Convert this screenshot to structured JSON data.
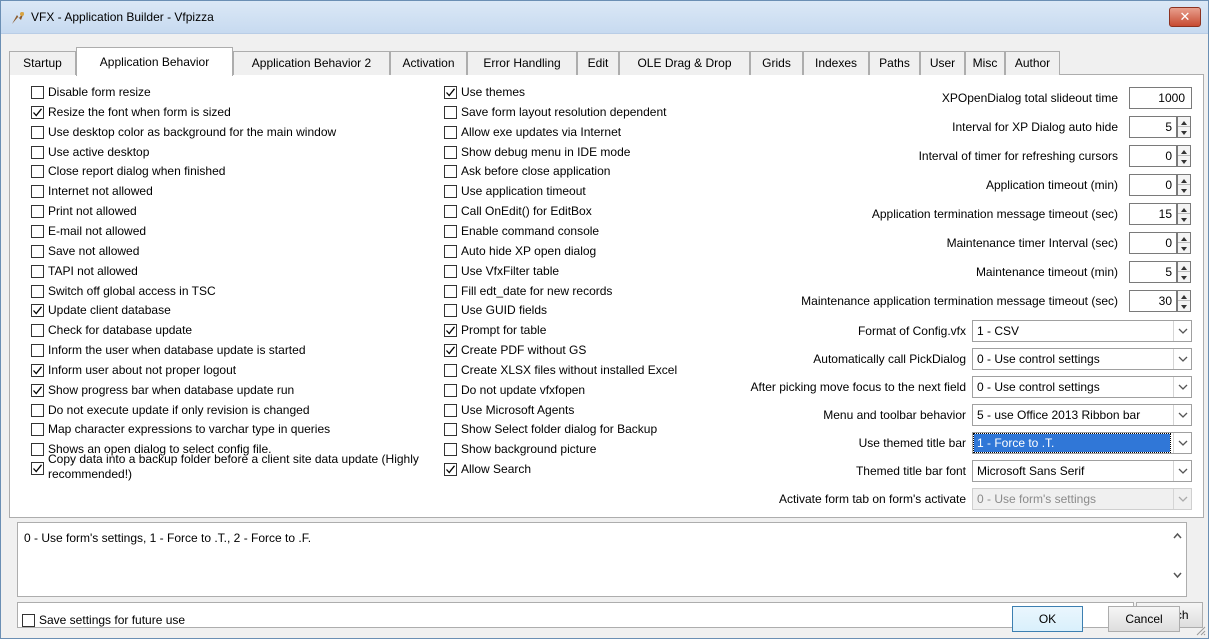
{
  "window": {
    "title": "VFX - Application Builder - Vfpizza",
    "close_label": "✕"
  },
  "tabs": [
    {
      "label": "Startup"
    },
    {
      "label": "Application Behavior"
    },
    {
      "label": "Application Behavior 2"
    },
    {
      "label": "Activation"
    },
    {
      "label": "Error Handling"
    },
    {
      "label": "Edit"
    },
    {
      "label": "OLE Drag & Drop"
    },
    {
      "label": "Grids"
    },
    {
      "label": "Indexes"
    },
    {
      "label": "Paths"
    },
    {
      "label": "User"
    },
    {
      "label": "Misc"
    },
    {
      "label": "Author"
    }
  ],
  "active_tab": "Application Behavior",
  "left_checks": [
    {
      "label": "Disable form resize",
      "checked": false
    },
    {
      "label": "Resize the font when form is sized",
      "checked": true
    },
    {
      "label": "Use desktop color as background for the main window",
      "checked": false
    },
    {
      "label": "Use active desktop",
      "checked": false
    },
    {
      "label": "Close report dialog when finished",
      "checked": false
    },
    {
      "label": "Internet not allowed",
      "checked": false
    },
    {
      "label": "Print not allowed",
      "checked": false
    },
    {
      "label": "E-mail not allowed",
      "checked": false
    },
    {
      "label": "Save not allowed",
      "checked": false
    },
    {
      "label": "TAPI not allowed",
      "checked": false
    },
    {
      "label": "Switch off global access in TSC",
      "checked": false
    },
    {
      "label": "Update client database",
      "checked": true
    },
    {
      "label": "Check for database update",
      "checked": false
    },
    {
      "label": "Inform the user when database update is started",
      "checked": false
    },
    {
      "label": "Inform user about not proper logout",
      "checked": true
    },
    {
      "label": "Show progress bar when database update run",
      "checked": true
    },
    {
      "label": "Do not execute update if only revision is changed",
      "checked": false
    },
    {
      "label": "Map character expressions to varchar type in queries",
      "checked": false
    },
    {
      "label": "Shows an open dialog to select config file.",
      "checked": false
    },
    {
      "label": "Copy data into a backup folder  before a client site data update (Highly recommended!)",
      "checked": true
    }
  ],
  "mid_checks": [
    {
      "label": "Use themes",
      "checked": true
    },
    {
      "label": "Save form layout resolution dependent",
      "checked": false
    },
    {
      "label": "Allow exe updates via Internet",
      "checked": false
    },
    {
      "label": "Show debug menu in IDE mode",
      "checked": false
    },
    {
      "label": "Ask before close application",
      "checked": false
    },
    {
      "label": "Use application timeout",
      "checked": false
    },
    {
      "label": "Call OnEdit() for EditBox",
      "checked": false
    },
    {
      "label": "Enable command console",
      "checked": false
    },
    {
      "label": "Auto hide XP open dialog",
      "checked": false
    },
    {
      "label": "Use VfxFilter table",
      "checked": false
    },
    {
      "label": "Fill edt_date for new records",
      "checked": false
    },
    {
      "label": "Use GUID fields",
      "checked": false
    },
    {
      "label": "Prompt for table",
      "checked": true
    },
    {
      "label": "Create PDF without GS",
      "checked": true
    },
    {
      "label": "Create XLSX files without installed Excel",
      "checked": false
    },
    {
      "label": "Do not update vfxfopen",
      "checked": false
    },
    {
      "label": "Use Microsoft Agents",
      "checked": false
    },
    {
      "label": "Show Select folder dialog for Backup",
      "checked": false
    },
    {
      "label": "Show background picture",
      "checked": false
    },
    {
      "label": "Allow Search",
      "checked": true
    }
  ],
  "numeric_settings": [
    {
      "label": "XPOpenDialog total slideout time",
      "value": "1000",
      "spinner": false
    },
    {
      "label": "Interval for XP Dialog auto hide",
      "value": "5",
      "spinner": true
    },
    {
      "label": "Interval of timer for refreshing cursors",
      "value": "0",
      "spinner": true
    },
    {
      "label": "Application timeout (min)",
      "value": "0",
      "spinner": true
    },
    {
      "label": "Application termination message timeout (sec)",
      "value": "15",
      "spinner": true
    },
    {
      "label": "Maintenance timer Interval (sec)",
      "value": "0",
      "spinner": true
    },
    {
      "label": "Maintenance timeout (min)",
      "value": "5",
      "spinner": true
    },
    {
      "label": "Maintenance application termination message timeout (sec)",
      "value": "30",
      "spinner": true
    }
  ],
  "combo_settings": [
    {
      "label": "Format of Config.vfx",
      "value": "1 - CSV",
      "selected": false,
      "disabled": false
    },
    {
      "label": "Automatically call PickDialog",
      "value": "0 - Use control settings",
      "selected": false,
      "disabled": false
    },
    {
      "label": "After picking move focus to the next field",
      "value": "0 - Use control settings",
      "selected": false,
      "disabled": false
    },
    {
      "label": "Menu and toolbar behavior",
      "value": "5 - use Office 2013 Ribbon bar",
      "selected": false,
      "disabled": false
    },
    {
      "label": "Use themed title bar",
      "value": "1 - Force to .T.",
      "selected": true,
      "disabled": false
    },
    {
      "label": "Themed title bar font",
      "value": "Microsoft Sans Serif",
      "selected": false,
      "disabled": false
    },
    {
      "label": "Activate form tab on form's activate",
      "value": "0 - Use form's settings",
      "selected": false,
      "disabled": true
    }
  ],
  "description": "0 - Use form's settings, 1 - Force to .T., 2 - Force to .F.",
  "search": {
    "value": "",
    "button_label": "Search"
  },
  "footer": {
    "save_settings_label": "Save settings for future use",
    "save_settings_checked": false,
    "ok_label": "OK",
    "cancel_label": "Cancel"
  }
}
